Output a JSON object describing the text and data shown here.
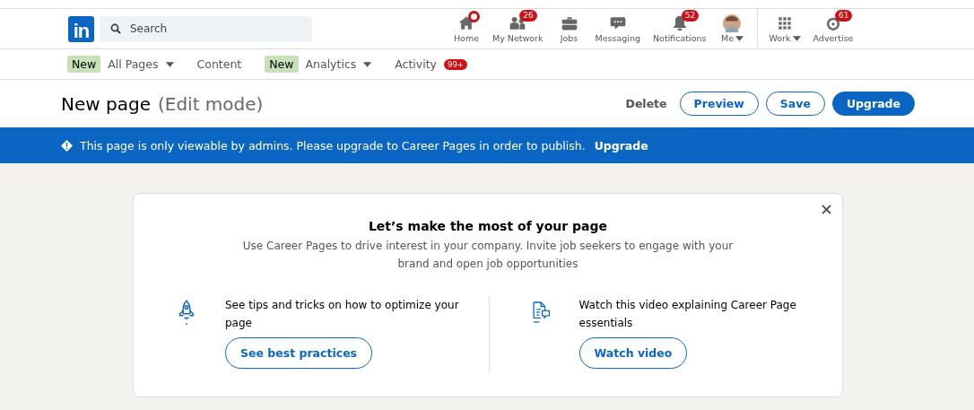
{
  "nav": {
    "logo": "in",
    "search": {
      "placeholder": "Search"
    },
    "items": [
      {
        "kind": "home",
        "label": "Home",
        "dot": true
      },
      {
        "kind": "network",
        "label": "My Network",
        "badge": "26"
      },
      {
        "kind": "jobs",
        "label": "Jobs"
      },
      {
        "kind": "messaging",
        "label": "Messaging"
      },
      {
        "kind": "bell",
        "label": "Notifications",
        "badge": "52"
      },
      {
        "kind": "avatar",
        "label": "Me",
        "dropdown": true
      },
      {
        "kind": "grid",
        "label": "Work",
        "dropdown": true,
        "divider_before": true
      },
      {
        "kind": "target",
        "label": "Advertise",
        "badge": "61"
      }
    ]
  },
  "subnav": {
    "items": [
      {
        "tag": "New",
        "label": "All Pages",
        "dropdown": true
      },
      {
        "label": "Content"
      },
      {
        "tag": "New",
        "label": "Analytics",
        "dropdown": true
      },
      {
        "label": "Activity",
        "badge": "99+"
      }
    ]
  },
  "header": {
    "title": "New page",
    "subtitle": "(Edit mode)",
    "actions": [
      {
        "kind": "text",
        "label": "Delete"
      },
      {
        "kind": "outline",
        "label": "Preview"
      },
      {
        "kind": "outline",
        "label": "Save"
      },
      {
        "kind": "primary",
        "label": "Upgrade"
      }
    ]
  },
  "banner": {
    "text": "This page is only viewable by admins. Please upgrade to Career Pages in order to publish.",
    "link": "Upgrade"
  },
  "card": {
    "title": "Let’s make the most of your page",
    "description": "Use Career Pages to drive interest in your company. Invite job seekers to engage with your brand and open job opportunities",
    "columns": [
      {
        "kind": "rocket",
        "text": "See tips and tricks on how to optimize your page",
        "button": "See best practices"
      },
      {
        "kind": "document",
        "text": "Watch this video explaining Career Page essentials",
        "button": "Watch video"
      }
    ]
  }
}
